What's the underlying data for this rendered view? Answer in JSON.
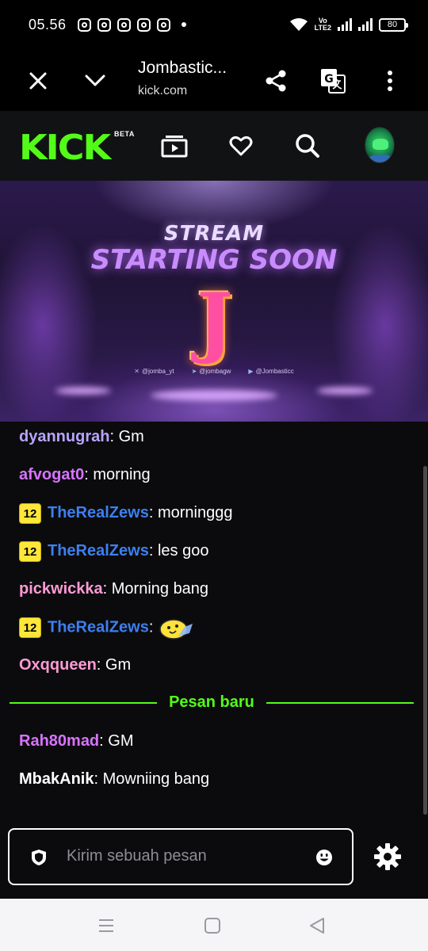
{
  "status_bar": {
    "time": "05.56",
    "battery": "80",
    "network": "Vo LTE2"
  },
  "browser": {
    "title": "Jombastic...",
    "url": "kick.com"
  },
  "kick": {
    "logo": "KICK",
    "beta": "BETA",
    "brand_color": "#53fc18"
  },
  "stream": {
    "line1": "STREAM",
    "line2": "STARTING SOON",
    "letter": "J",
    "socials": [
      {
        "icon": "x-icon",
        "handle": "@jomba_yt"
      },
      {
        "icon": "telegram-icon",
        "handle": "@jombagw"
      },
      {
        "icon": "youtube-icon",
        "handle": "@Jombasticc"
      }
    ]
  },
  "chat": {
    "messages": [
      {
        "user": "dyannugrah",
        "text": "Gm",
        "color": "#b9a3ff",
        "badge": ""
      },
      {
        "user": "afvogat0",
        "text": "morning",
        "color": "#d873ff",
        "badge": ""
      },
      {
        "user": "TheRealZews",
        "text": "morninggg",
        "color": "#3d7ff0",
        "badge": "12"
      },
      {
        "user": "TheRealZews",
        "text": "les goo",
        "color": "#3d7ff0",
        "badge": "12"
      },
      {
        "user": "pickwickka",
        "text": "Morning bang",
        "color": "#ff9ad5",
        "badge": ""
      },
      {
        "user": "TheRealZews",
        "text": "",
        "color": "#3d7ff0",
        "badge": "12",
        "emote": "bee-emote"
      },
      {
        "user": "Oxqqueen",
        "text": "Gm",
        "color": "#ff9ad5",
        "badge": ""
      },
      {
        "user": "Rah80mad",
        "text": "GM",
        "color": "#d873ff",
        "badge": ""
      },
      {
        "user": "MbakAnik",
        "text": "Mowniing bang",
        "color": "#ffffff",
        "badge": ""
      }
    ],
    "new_messages_label": "Pesan baru",
    "input_placeholder": "Kirim sebuah pesan"
  }
}
